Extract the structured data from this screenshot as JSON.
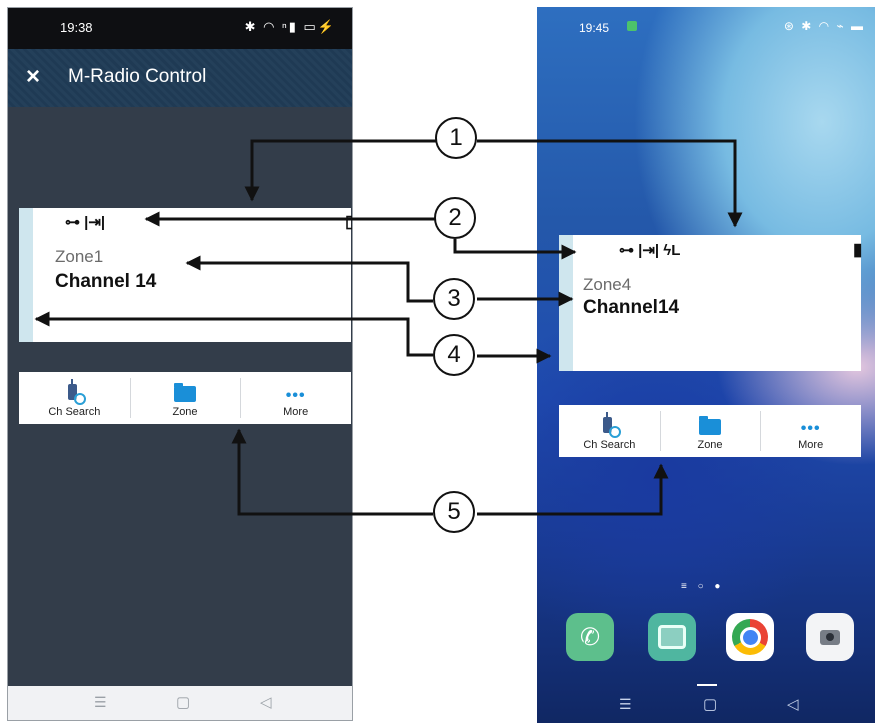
{
  "left_phone": {
    "status_bar": {
      "time": "19:38",
      "icons": "✱ ◠ ⁿ▮ ▭⚡"
    },
    "app_bar": {
      "close_icon": "×",
      "title": "M-Radio Control"
    },
    "widget": {
      "status_icons": "⊶ |⇥|",
      "battery": "▯",
      "zone": "Zone1",
      "channel": "Channel 14"
    },
    "buttons": [
      {
        "label": "Ch Search",
        "icon": "radio-search-icon"
      },
      {
        "label": "Zone",
        "icon": "folder-icon"
      },
      {
        "label": "More",
        "icon": "more-dots-icon"
      }
    ],
    "nav": {
      "menu": "☰",
      "home": "▢",
      "back": "◁"
    }
  },
  "right_phone": {
    "status_bar": {
      "time": "19:45",
      "icons": "⊛ ✱ ◠ ⌁ ▬"
    },
    "widget": {
      "status_icons": "⊶ |⇥| ϟL",
      "battery": "▮",
      "zone": "Zone4",
      "channel": "Channel14"
    },
    "buttons": [
      {
        "label": "Ch Search",
        "icon": "radio-search-icon"
      },
      {
        "label": "Zone",
        "icon": "folder-icon"
      },
      {
        "label": "More",
        "icon": "more-dots-icon"
      }
    ],
    "page_dots": "≡ ○ ●",
    "dock": [
      "phone-app-icon",
      "messages-app-icon",
      "chrome-app-icon",
      "camera-app-icon"
    ],
    "nav": {
      "menu": "☰",
      "home": "▢",
      "back": "◁"
    }
  },
  "callouts": [
    "1",
    "2",
    "3",
    "4",
    "5"
  ],
  "colors": {
    "card_accent": "#cfe6ee",
    "icon_blue": "#1a8fd8",
    "app_bar": "#24405a",
    "left_background": "#333d4a"
  }
}
